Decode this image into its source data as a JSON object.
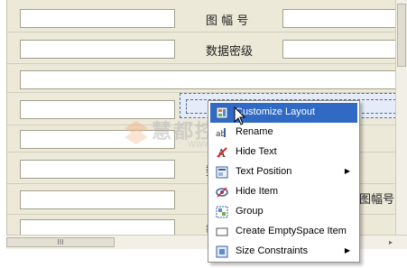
{
  "form": {
    "label_figure_no": "图 幅 号",
    "label_secret_level": "数据密级",
    "label_partial_1": "数",
    "label_figure_no_2": "图幅号",
    "label_partial_2": "数"
  },
  "context_menu": {
    "items": [
      {
        "label": "Customize Layout",
        "icon": "customize-layout-icon",
        "selected": true,
        "submenu": false
      },
      {
        "label": "Rename",
        "icon": "rename-icon",
        "selected": false,
        "submenu": false
      },
      {
        "label": "Hide Text",
        "icon": "hide-text-icon",
        "selected": false,
        "submenu": false
      },
      {
        "label": "Text Position",
        "icon": "text-position-icon",
        "selected": false,
        "submenu": true
      },
      {
        "label": "Hide Item",
        "icon": "hide-item-icon",
        "selected": false,
        "submenu": false
      },
      {
        "label": "Group",
        "icon": "group-icon",
        "selected": false,
        "submenu": false
      },
      {
        "label": "Create EmptySpace Item",
        "icon": "empty-space-icon",
        "selected": false,
        "submenu": false
      },
      {
        "label": "Size Constraints",
        "icon": "size-constraints-icon",
        "selected": false,
        "submenu": true
      }
    ],
    "submenu_arrow": "▶"
  },
  "scrollbar": {
    "grip": "III",
    "right_arrow": "▸"
  },
  "watermark": {
    "text": "慧都控件网",
    "sub": "WWW.EVGET.COM"
  },
  "colors": {
    "selection": "#316ac5",
    "panel": "#ece9d8",
    "field_border": "#a3a08c"
  }
}
